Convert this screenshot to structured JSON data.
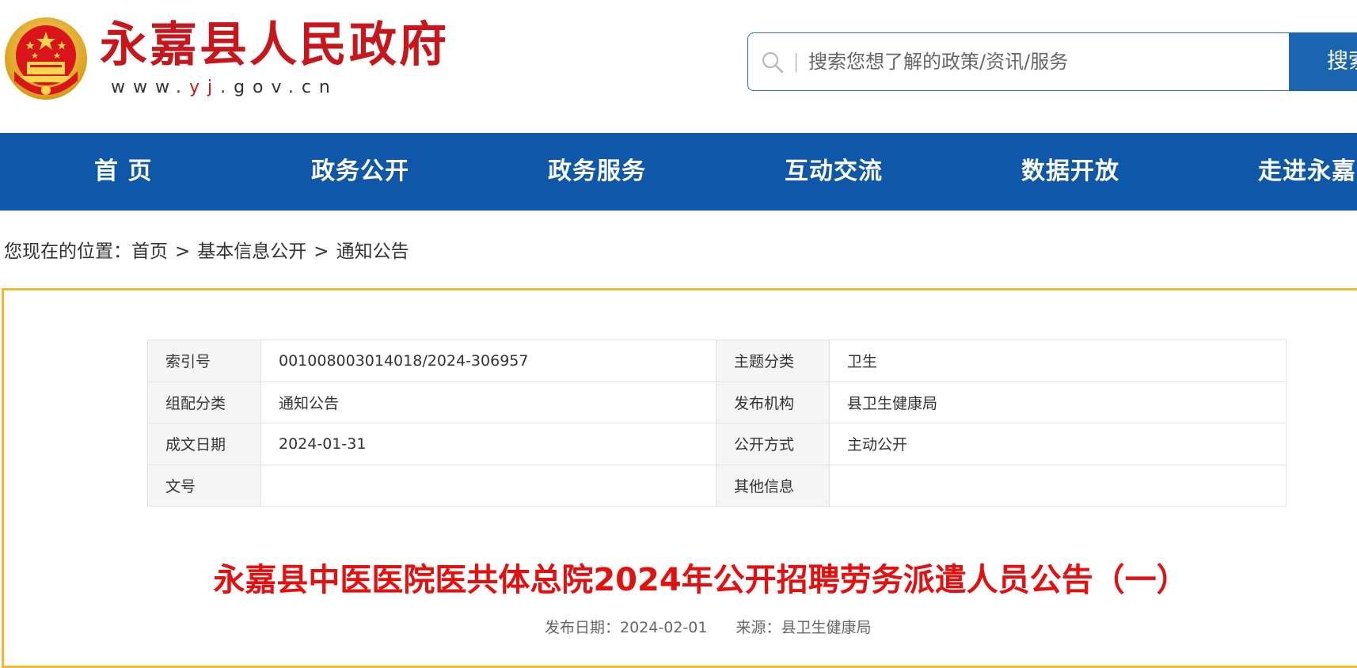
{
  "header": {
    "site_name": "永嘉县人民政府",
    "url_prefix": "www.",
    "url_highlight": "yj",
    "url_suffix": ".gov.cn",
    "brand_red": "#c8161d",
    "brand_blue": "#0f57a8"
  },
  "search": {
    "placeholder": "搜索您想了解的政策/资讯/服务",
    "button_label": "搜索",
    "icon": "search-icon"
  },
  "nav": {
    "items": [
      {
        "label": "首 页"
      },
      {
        "label": "政务公开"
      },
      {
        "label": "政务服务"
      },
      {
        "label": "互动交流"
      },
      {
        "label": "数据开放"
      },
      {
        "label": "走进永嘉"
      }
    ]
  },
  "breadcrumb": {
    "prefix": "您现在的位置：",
    "items": [
      "首页",
      "基本信息公开",
      "通知公告"
    ],
    "separator": ">"
  },
  "meta": {
    "rows": [
      {
        "label1": "索引号",
        "value1": "001008003014018/2024-306957",
        "label2": "主题分类",
        "value2": "卫生"
      },
      {
        "label1": "组配分类",
        "value1": "通知公告",
        "label2": "发布机构",
        "value2": "县卫生健康局"
      },
      {
        "label1": "成文日期",
        "value1": "2024-01-31",
        "label2": "公开方式",
        "value2": "主动公开"
      },
      {
        "label1": "文号",
        "value1": "",
        "label2": "其他信息",
        "value2": ""
      }
    ]
  },
  "article": {
    "title": "永嘉县中医医院医共体总院2024年公开招聘劳务派遣人员公告（一）",
    "date_label": "发布日期：",
    "date": "2024-02-01",
    "source_label": "来源：",
    "source": "县卫生健康局",
    "title_color": "#e3100f"
  }
}
